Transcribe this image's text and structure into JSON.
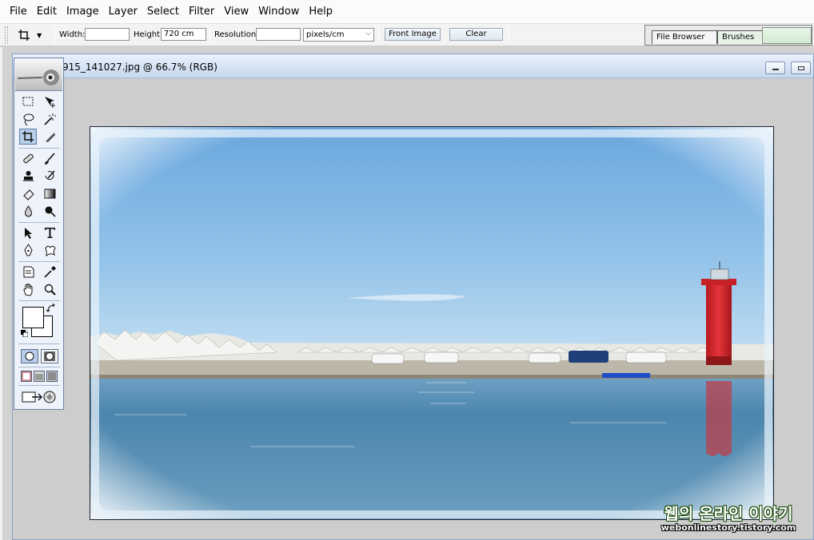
{
  "menu": [
    "File",
    "Edit",
    "Image",
    "Layer",
    "Select",
    "Filter",
    "View",
    "Window",
    "Help"
  ],
  "options": {
    "width_label": "Width:",
    "width_value": "",
    "height_label": "Height:",
    "height_value": "720 cm",
    "resolution_label": "Resolution:",
    "resolution_value": "",
    "units_value": "pixels/cm",
    "front_image_label": "Front Image",
    "clear_label": "Clear"
  },
  "palette_well": {
    "tabs": [
      "File Browser",
      "Brushes"
    ]
  },
  "document": {
    "title": "915_141027.jpg @ 66.7% (RGB)"
  },
  "toolbox": {
    "active_tool": "crop-tool",
    "tools": [
      "rectangular-marquee",
      "move",
      "lasso",
      "magic-wand",
      "crop",
      "slice",
      "healing-brush",
      "brush",
      "clone-stamp",
      "history-brush",
      "eraser",
      "gradient",
      "blur",
      "dodge",
      "path-selection",
      "type",
      "pen",
      "custom-shape",
      "notes",
      "eyedropper",
      "hand",
      "zoom"
    ],
    "foreground_color": "#ffffff",
    "background_color": "#ffffff"
  },
  "watermark": {
    "korean": "웹의 온라인 이야기",
    "url": "webonlinestory.tistory.com"
  },
  "colors": {
    "accent": "#b7cde9",
    "lighthouse": "#d8242a",
    "sky": "#8fbfe6",
    "sea": "#4f8cb3"
  }
}
